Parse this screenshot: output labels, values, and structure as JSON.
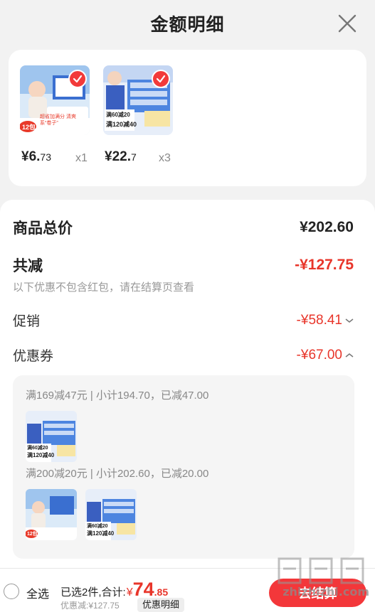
{
  "header": {
    "title": "金额明细",
    "close_icon": "close-icon"
  },
  "products": [
    {
      "price_int": "¥6.",
      "price_dec": "73",
      "qty": "x1",
      "badge": "12包",
      "promo": "超省加满分 清爽系“卷子”"
    },
    {
      "price_int": "¥22.",
      "price_dec": "7",
      "qty": "x3",
      "tag1": "满60减20",
      "tag2": "满120减40"
    }
  ],
  "summary": {
    "total_label": "商品总价",
    "total_value": "¥202.60",
    "discount_label": "共减",
    "discount_value": "-¥127.75",
    "note": "以下优惠不包含红包，请在结算页查看",
    "promo_label": "促销",
    "promo_value": "-¥58.41",
    "coupon_label": "优惠券",
    "coupon_value": "-¥67.00"
  },
  "coupons": [
    {
      "text": "满169减47元 | 小计194.70，已减47.00",
      "tag1": "满60减20",
      "tag2": "满120减40"
    },
    {
      "text": "满200减20元 | 小计202.60，已减20.00",
      "badge": "12包",
      "tag1": "满60减20",
      "tag2": "满120减40"
    }
  ],
  "bottom": {
    "select_all": "全选",
    "selected_text": "已选2件,合计:",
    "currency": "¥",
    "total_int": "74",
    "total_dec": ".85",
    "saving": "优惠减:¥127.75",
    "detail_button": "优惠明细",
    "checkout_button": "去结算",
    "watermark": "zhizhizhi.com"
  },
  "colors": {
    "accent_red": "#e8352a",
    "product_blue": "#2f5fcf",
    "background": "#f2f2f2"
  }
}
